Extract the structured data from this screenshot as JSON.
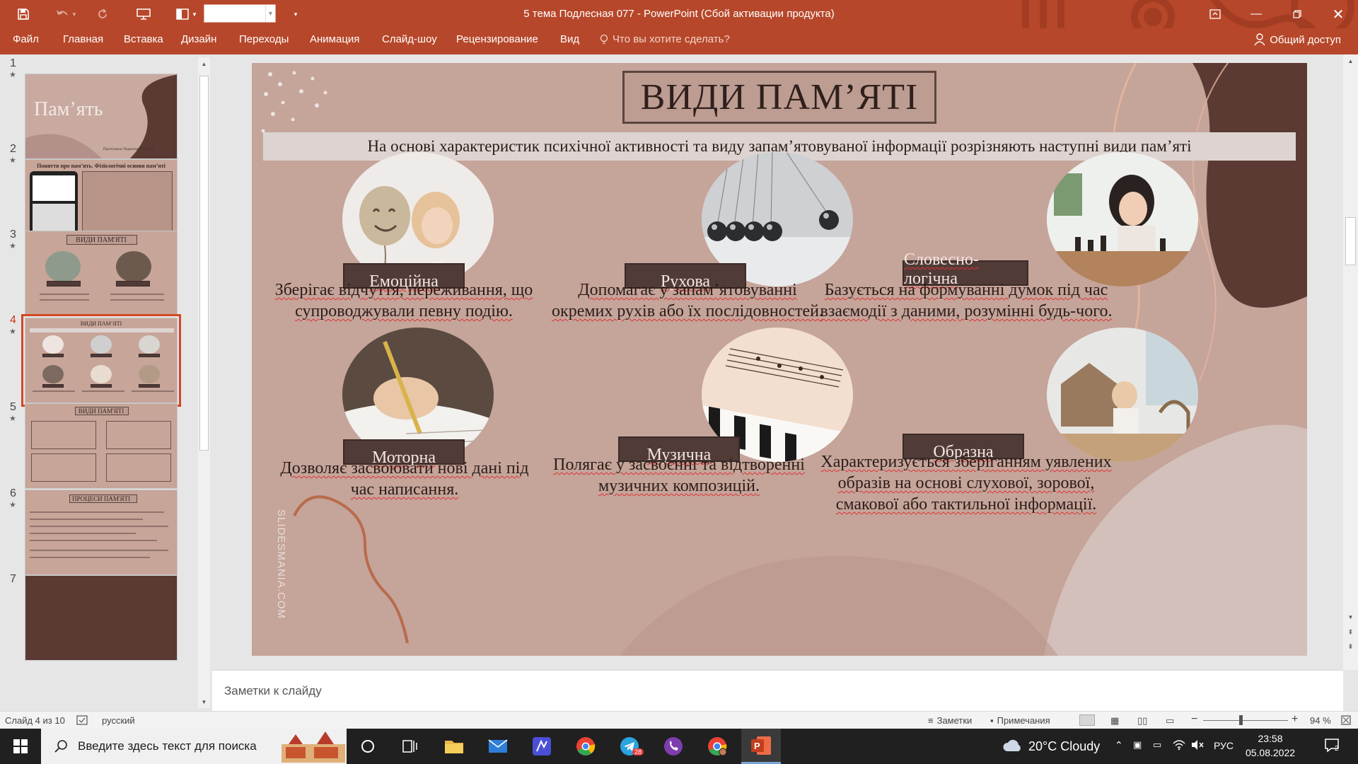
{
  "titlebar": {
    "title": "5 тема Подлесная 077 - PowerPoint (Сбой активации продукта)",
    "font_size_value": ""
  },
  "ribbon": {
    "tabs": [
      "Файл",
      "Главная",
      "Вставка",
      "Дизайн",
      "Переходы",
      "Анимация",
      "Слайд-шоу",
      "Рецензирование",
      "Вид"
    ],
    "tell_me": "Что вы хотите сделать?",
    "share": "Общий доступ"
  },
  "thumbnails": {
    "numbers": [
      "1",
      "2",
      "3",
      "4",
      "5",
      "6",
      "7"
    ],
    "t1_title": "Пам’ять",
    "t1_caption": "Підготувала: Подлесна 077 група",
    "t2_title": "Поняття про пам’ять. Фізіологічні основи пам’яті",
    "t3_title": "ВИДИ ПАМ'ЯТІ",
    "t4_title": "ВИДИ ПАМ’ЯТІ",
    "t5_title": "ВИДИ ПАМ'ЯТІ",
    "t6_title": "ПРОЦЕСИ ПАМ'ЯТІ"
  },
  "slide": {
    "title": "ВИДИ ПАМ’ЯТІ",
    "subtitle": "На основі характеристик психічної активності та виду запам’ятовуваної інформації розрізняють наступні види пам’яті",
    "watermark": "SLIDESMANIA.COM",
    "cards": [
      {
        "label": "Емоційна",
        "desc_1": "Зберігає відчуття, переживання, що",
        "desc_2": "супроводжували певну подію."
      },
      {
        "label": "Рухова",
        "desc_1": "Допомагає у запам’ятовуванні",
        "desc_2": "окремих рухів або їх послідовностей."
      },
      {
        "label": "Словесно-логічна",
        "desc_1": "Базується на формуванні думок під час",
        "desc_2": "взаємодії з даними, розумінні будь-чого."
      },
      {
        "label": "Моторна",
        "desc_1": "Дозволяє засвоювати нові дані під",
        "desc_2": "час написання."
      },
      {
        "label": "Музична",
        "desc_1": "Полягає у засвоєнні та відтворенні",
        "desc_2": "музичних композицій."
      },
      {
        "label": "Образна",
        "desc_1": "Характеризується зберіганням уявлених",
        "desc_2": "образів на основі слухової, зорової,",
        "desc_3": "смакової або тактильної інформації."
      }
    ]
  },
  "notes": {
    "placeholder": "Заметки к слайду"
  },
  "statusbar": {
    "slide_of": "Слайд 4 из 10",
    "language": "русский",
    "notes_btn": "Заметки",
    "comments_btn": "Примечания",
    "zoom": "94 %"
  },
  "taskbar": {
    "search_placeholder": "Введите здесь текст для поиска",
    "weather": "20°C  Cloudy",
    "lang": "РУС",
    "time": "23:58",
    "date": "05.08.2022",
    "telegram_badge": "28",
    "notif_count": "2"
  },
  "colors": {
    "accent": "#b7472a",
    "slide_bg": "#c5a49a",
    "label_bg": "#503b37",
    "selection": "#d24726"
  }
}
